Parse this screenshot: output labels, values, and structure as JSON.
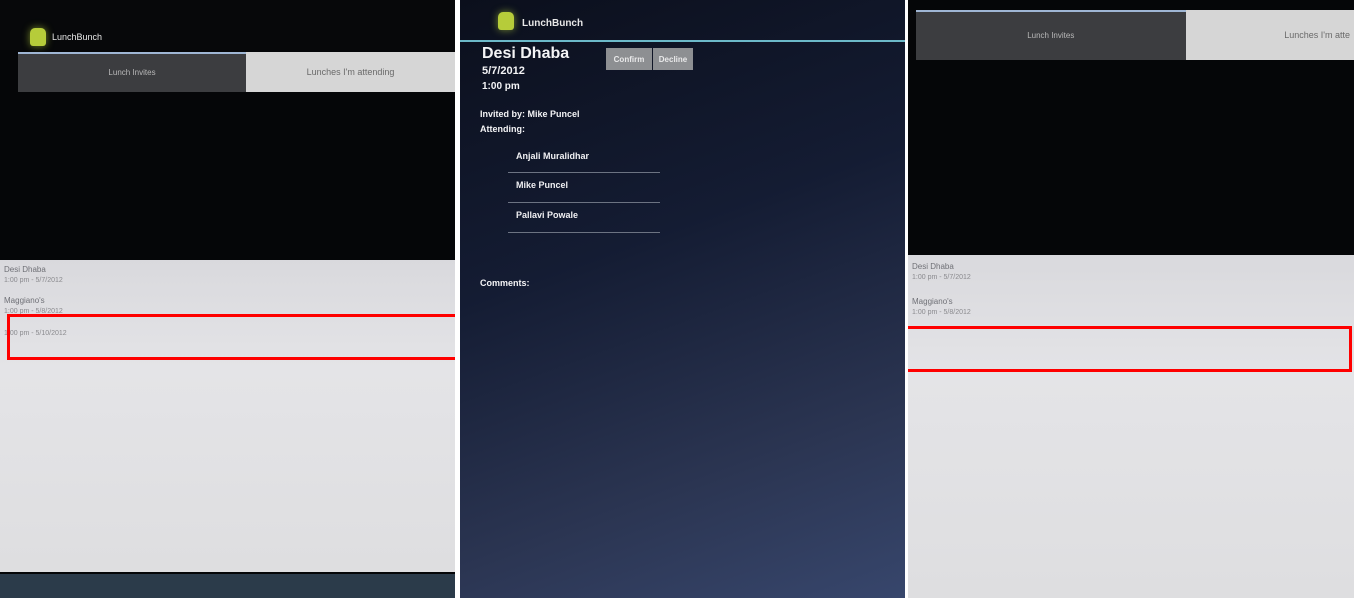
{
  "left_panel": {
    "app_title": "LunchBunch",
    "tabs": [
      "Lunch Invites",
      "Lunches I'm attending"
    ],
    "list": [
      {
        "name": "Desi Dhaba",
        "detail": "1:00 pm - 5/7/2012"
      },
      {
        "name": "Maggiano's",
        "detail": "1:00 pm - 5/8/2012"
      },
      {
        "name": "",
        "detail": "1:00 pm - 5/10/2012"
      }
    ]
  },
  "middle_panel": {
    "app_title": "LunchBunch",
    "event_name": "Desi Dhaba",
    "date": "5/7/2012",
    "time": "1:00 pm",
    "buttons": [
      "Confirm",
      "Decline"
    ],
    "invited_by": "Invited by: Mike Puncel",
    "attending_label": "Attending:",
    "attendees": [
      "Anjali Muralidhar",
      "Mike Puncel",
      "Pallavi Powale"
    ],
    "comments_label": "Comments:"
  },
  "right_panel": {
    "tabs": [
      "Lunch Invites",
      "Lunches I'm atte"
    ],
    "list": [
      {
        "name": "Desi Dhaba",
        "detail": "1:00 pm - 5/7/2012"
      },
      {
        "name": "Maggiano's",
        "detail": "1:00 pm - 5/8/2012"
      }
    ]
  },
  "colors": {
    "highlight": "#ff0000",
    "tab_indicator": "#6cb9c9",
    "android_icon": "#b6cc3a"
  }
}
